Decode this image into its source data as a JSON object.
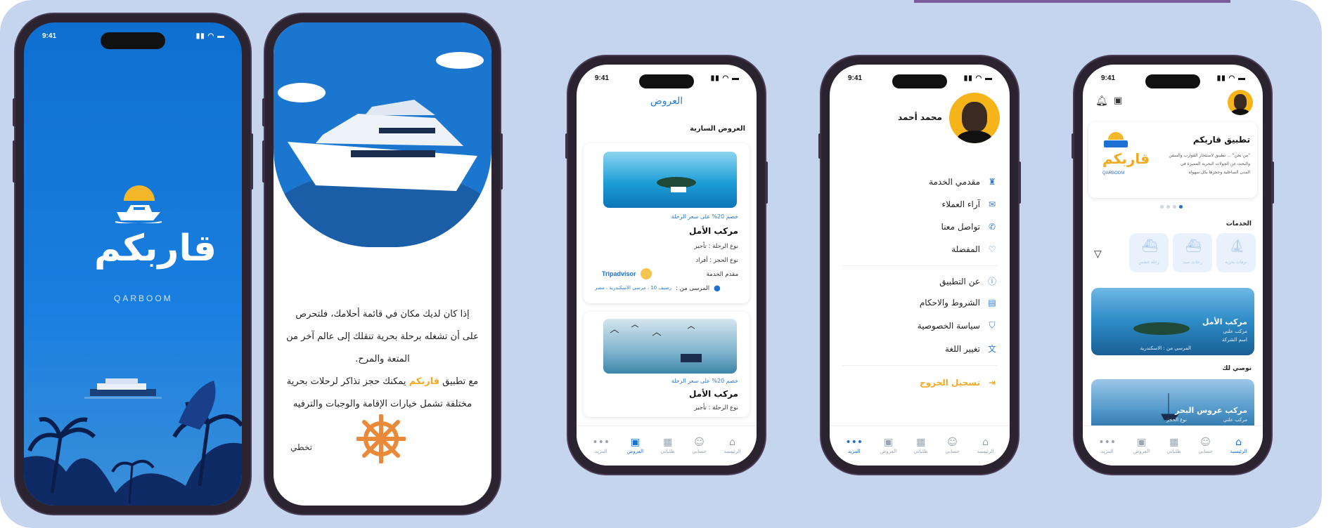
{
  "colors": {
    "panel": "#c5d5ee",
    "primary": "#1d6fd4",
    "accent": "#f5b72a"
  },
  "status": {
    "time": "9:41"
  },
  "splash": {
    "logo": "قاربكم",
    "logo_latin": "QARBOOM"
  },
  "onboarding": {
    "line1": "إذا كان لديك مكان في قائمة أحلامك، فلتحرص",
    "line2": "على أن تشغله برحلة بحرية تنقلك إلى عالم آخر من",
    "line3": "المتعة والمرح.",
    "line4_pre": "مع تطبيق",
    "line4_app": "قاربكم",
    "line4_post": "يمكنك حجز تذاكر لرحلات بحرية",
    "line5": "مختلفة تشمل خيارات الإقامة والوجبات والترفيه",
    "skip": "تخطي"
  },
  "offers": {
    "title": "العروض",
    "section": "العروض السارية",
    "card1": {
      "discount": "خصم 20% على سعر الرحلة",
      "name": "مركب الأمل",
      "trip_type_label": "نوع الرحلة :",
      "trip_type": "تأجير",
      "booking_type_label": "نوع الحجز :",
      "booking_type": "أفراد",
      "provider_label": "مقدم الخدمة",
      "provider": "Tripadvisor",
      "location_label": "المرسى من :",
      "location": "رصيف 10 ، مرسى الاسكندرية ، مصر"
    },
    "card2": {
      "discount": "خصم 20% على سعر الرحلة",
      "name": "مركب الأمل",
      "trip_type_label": "نوع الرحلة :",
      "trip_type": "تأجير"
    }
  },
  "nav": {
    "home": "الرئيسية",
    "account": "حسابي",
    "orders": "طلباتي",
    "offers": "العروض",
    "more": "المزيد"
  },
  "profile": {
    "name": "محمد أحمد",
    "items": [
      "مقدمي الخدمة",
      "آراء العملاء",
      "تواصل معنا",
      "المفضلة",
      "عن التطبيق",
      "الشروط والاحكام",
      "سياسة الخصوصية",
      "تغيير اللغة"
    ],
    "logout": "تسجيل الخروج"
  },
  "home": {
    "app_title": "تطبيق قاربكم",
    "about_lines": [
      "\"من نحن\" ... تطبيق لاستئجار القوارب والسفن",
      "والبحث عن الجولات البحرية المميزة في",
      "المدن الساحلية وحجزها بكل سهولة"
    ],
    "brand": "QARBOOM",
    "services_label": "الخدمات",
    "services": [
      "نزهات بحرية",
      "رحلات صيد",
      "رحلة غطس"
    ],
    "boat1": {
      "name": "مركب الأمل",
      "type": "مركب علني",
      "line2": "اسم الشركة",
      "line3": "المرسى من : الاسكندرية"
    },
    "recommended": "نوصي لك",
    "boat2": {
      "name": "مركب عروس البحر",
      "type": "مركب علني",
      "line2": "نوع الحجز"
    }
  }
}
